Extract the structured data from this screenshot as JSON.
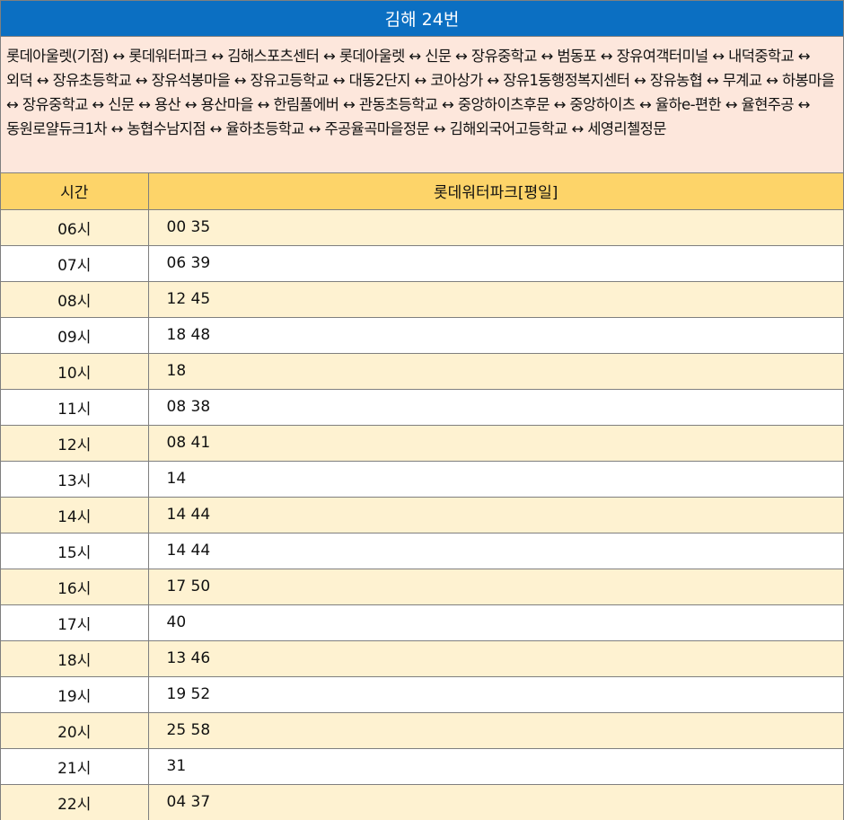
{
  "header": {
    "title": "김해 24번"
  },
  "route": {
    "text": "롯데아울렛(기점) ↔ 롯데워터파크 ↔ 김해스포츠센터 ↔ 롯데아울렛 ↔ 신문 ↔ 장유중학교 ↔ 범동포 ↔ 장유여객터미널 ↔ 내덕중학교 ↔ 외덕 ↔ 장유초등학교 ↔ 장유석봉마을 ↔ 장유고등학교 ↔ 대동2단지 ↔ 코아상가 ↔ 장유1동행정복지센터 ↔ 장유농협 ↔ 무계교 ↔ 하봉마을 ↔ 장유중학교 ↔ 신문 ↔ 용산 ↔ 용산마을 ↔ 한림풀에버 ↔ 관동초등학교 ↔ 중앙하이츠후문 ↔ 중앙하이츠 ↔ 율하e-편한 ↔ 율현주공 ↔ 동원로얄듀크1차 ↔ 농협수남지점 ↔ 율하초등학교 ↔ 주공율곡마을정문 ↔ 김해외국어고등학교 ↔ 세영리첼정문"
  },
  "table": {
    "columns": [
      "시간",
      "롯데워터파크[평일]"
    ],
    "rows": [
      {
        "hour": "06시",
        "times": "00 35"
      },
      {
        "hour": "07시",
        "times": "06 39"
      },
      {
        "hour": "08시",
        "times": "12 45"
      },
      {
        "hour": "09시",
        "times": "18 48"
      },
      {
        "hour": "10시",
        "times": "18"
      },
      {
        "hour": "11시",
        "times": "08 38"
      },
      {
        "hour": "12시",
        "times": "08 41"
      },
      {
        "hour": "13시",
        "times": "14"
      },
      {
        "hour": "14시",
        "times": "14 44"
      },
      {
        "hour": "15시",
        "times": "14 44"
      },
      {
        "hour": "16시",
        "times": "17 50"
      },
      {
        "hour": "17시",
        "times": "40"
      },
      {
        "hour": "18시",
        "times": "13 46"
      },
      {
        "hour": "19시",
        "times": "19 52"
      },
      {
        "hour": "20시",
        "times": "25 58"
      },
      {
        "hour": "21시",
        "times": "31"
      },
      {
        "hour": "22시",
        "times": "04 37"
      }
    ]
  }
}
